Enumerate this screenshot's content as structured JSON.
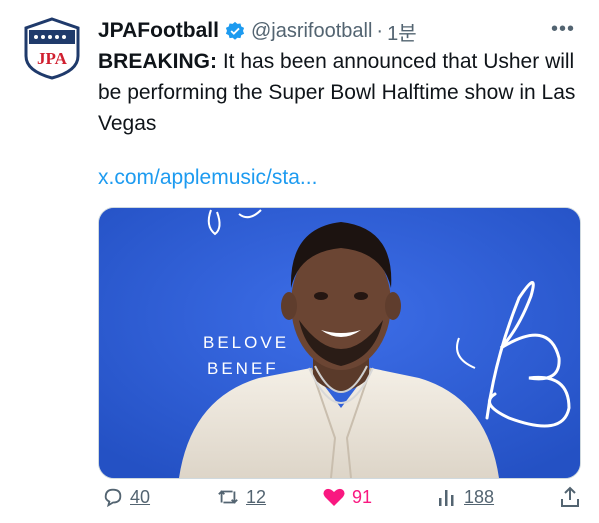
{
  "account": {
    "display_name": "JPAFootball",
    "handle": "@jasrifootball",
    "separator": "·",
    "time": "1분",
    "avatar_text": "JPA"
  },
  "tweet": {
    "bold_prefix": "BREAKING:",
    "text": " It has been announced that Usher will be performing the Super Bowl Halftime show in Las Vegas",
    "link": "x.com/applemusic/sta..."
  },
  "media": {
    "backdrop_text_line1": "BELOVE",
    "backdrop_text_line2": "BENEF",
    "logo_glyph": "B"
  },
  "actions": {
    "replies": "40",
    "retweets": "12",
    "likes": "91",
    "views": "188"
  },
  "colors": {
    "accent": "#1d9bf0",
    "like": "#f91880",
    "muted": "#536471",
    "backdrop": "#2d5fd4"
  }
}
